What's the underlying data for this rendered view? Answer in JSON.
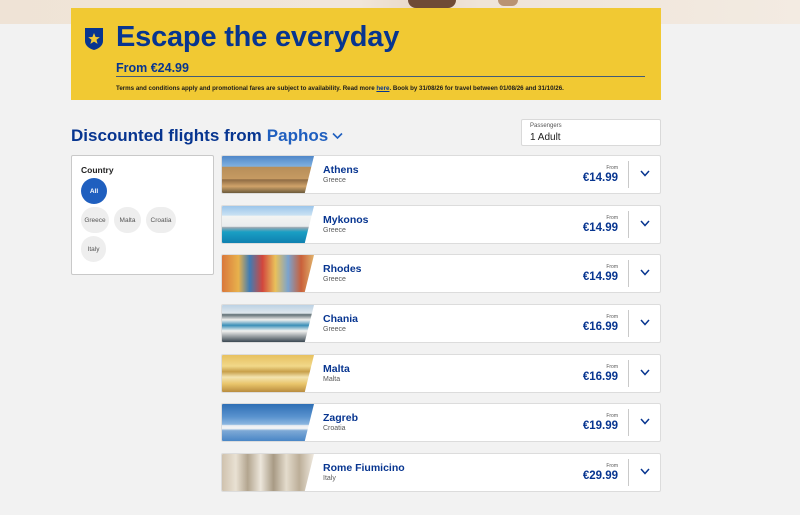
{
  "colors": {
    "brand_blue": "#073590",
    "accent_blue": "#1f5fbf",
    "promo_yellow": "#f1c933",
    "page_bg": "#f2f2f2"
  },
  "promo": {
    "icon": "shield-star-icon",
    "title": "Escape the everyday",
    "from_price": "From €24.99",
    "terms_before": "Terms and conditions apply and promotional fares are subject to availability. Read more ",
    "terms_link": "here",
    "terms_after": ". Book by 31/08/26 for travel between 01/08/26 and 31/10/26."
  },
  "heading": {
    "prefix": "Discounted flights from",
    "city": "Paphos",
    "icon": "chevron-down-icon"
  },
  "passengers": {
    "label": "Passengers",
    "value": "1 Adult"
  },
  "filter": {
    "title": "Country",
    "chips": [
      {
        "label": "All",
        "active": true
      },
      {
        "label": "Greece",
        "active": false
      },
      {
        "label": "Malta",
        "active": false
      },
      {
        "label": "Croatia",
        "active": false
      },
      {
        "label": "Italy",
        "active": false
      }
    ]
  },
  "flights": [
    {
      "destination": "Athens",
      "country": "Greece",
      "from_label": "From",
      "price": "€14.99",
      "photo": "parthenon"
    },
    {
      "destination": "Mykonos",
      "country": "Greece",
      "from_label": "From",
      "price": "€14.99",
      "photo": "whitewash-harbour"
    },
    {
      "destination": "Rhodes",
      "country": "Greece",
      "from_label": "From",
      "price": "€14.99",
      "photo": "colourful-houses"
    },
    {
      "destination": "Chania",
      "country": "Greece",
      "from_label": "From",
      "price": "€16.99",
      "photo": "waterfront-cafes"
    },
    {
      "destination": "Malta",
      "country": "Malta",
      "from_label": "From",
      "price": "€16.99",
      "photo": "sunlit-harbour"
    },
    {
      "destination": "Zagreb",
      "country": "Croatia",
      "from_label": "From",
      "price": "€19.99",
      "photo": "aircraft-sky"
    },
    {
      "destination": "Rome Fiumicino",
      "country": "Italy",
      "from_label": "From",
      "price": "€29.99",
      "photo": "trevi-fountain"
    }
  ]
}
